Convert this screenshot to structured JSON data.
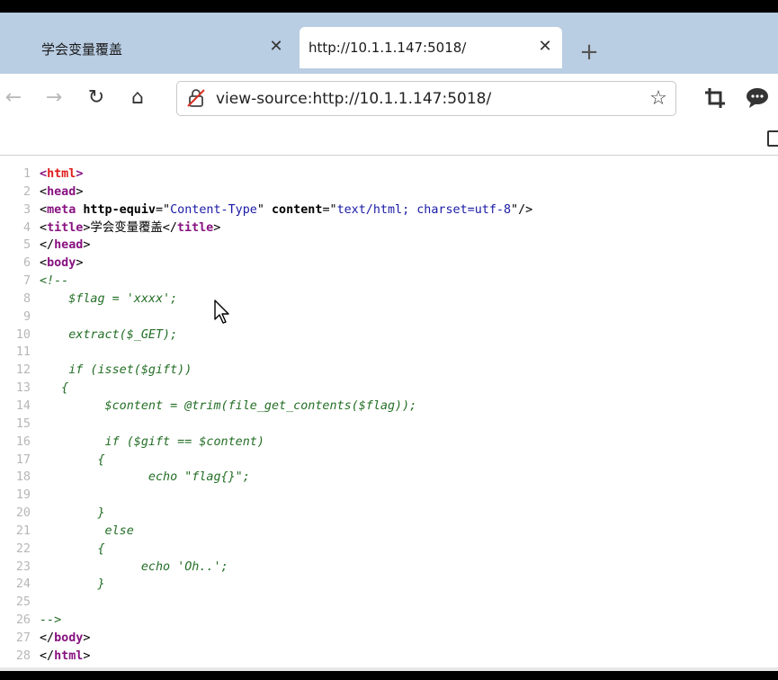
{
  "tabs": [
    {
      "title": "学会变量覆盖",
      "close": "✕"
    },
    {
      "title": "http://10.1.1.147:5018/",
      "close": "✕"
    }
  ],
  "new_tab": "+",
  "nav": {
    "back": "←",
    "forward": "→",
    "reload": "↻",
    "home": "⌂",
    "bookmark": "☆"
  },
  "address": {
    "url": "view-source:http://10.1.1.147:5018/"
  },
  "source_lines": [
    {
      "n": "1",
      "tokens": [
        {
          "c": "t-tag",
          "t": "<"
        },
        {
          "c": "t-root",
          "t": "html"
        },
        {
          "c": "t-tag",
          "t": ">"
        }
      ]
    },
    {
      "n": "2",
      "tokens": [
        {
          "c": "t-txt",
          "t": "<"
        },
        {
          "c": "t-tag",
          "t": "head"
        },
        {
          "c": "t-txt",
          "t": ">"
        }
      ]
    },
    {
      "n": "3",
      "tokens": [
        {
          "c": "t-txt",
          "t": "<"
        },
        {
          "c": "t-tag",
          "t": "meta"
        },
        {
          "c": "t-txt",
          "t": " "
        },
        {
          "c": "t-attr",
          "t": "http-equiv"
        },
        {
          "c": "t-txt",
          "t": "=\""
        },
        {
          "c": "t-val",
          "t": "Content-Type"
        },
        {
          "c": "t-txt",
          "t": "\" "
        },
        {
          "c": "t-attr",
          "t": "content"
        },
        {
          "c": "t-txt",
          "t": "=\""
        },
        {
          "c": "t-val",
          "t": "text/html; charset=utf-8"
        },
        {
          "c": "t-txt",
          "t": "\"/>"
        }
      ]
    },
    {
      "n": "4",
      "tokens": [
        {
          "c": "t-txt",
          "t": "<"
        },
        {
          "c": "t-tag",
          "t": "title"
        },
        {
          "c": "t-txt",
          "t": ">学会变量覆盖</"
        },
        {
          "c": "t-tag",
          "t": "title"
        },
        {
          "c": "t-txt",
          "t": ">"
        }
      ]
    },
    {
      "n": "5",
      "tokens": [
        {
          "c": "t-txt",
          "t": "</"
        },
        {
          "c": "t-tag",
          "t": "head"
        },
        {
          "c": "t-txt",
          "t": ">"
        }
      ]
    },
    {
      "n": "6",
      "tokens": [
        {
          "c": "t-txt",
          "t": "<"
        },
        {
          "c": "t-tag",
          "t": "body"
        },
        {
          "c": "t-txt",
          "t": ">"
        }
      ]
    },
    {
      "n": "7",
      "tokens": [
        {
          "c": "t-cmt",
          "t": "<!--"
        }
      ]
    },
    {
      "n": "8",
      "tokens": [
        {
          "c": "t-cmt",
          "t": "    $flag = 'xxxx';"
        }
      ]
    },
    {
      "n": "9",
      "tokens": []
    },
    {
      "n": "10",
      "tokens": [
        {
          "c": "t-cmt",
          "t": "    extract($_GET);"
        }
      ]
    },
    {
      "n": "11",
      "tokens": []
    },
    {
      "n": "12",
      "tokens": [
        {
          "c": "t-cmt",
          "t": "    if (isset($gift))"
        }
      ]
    },
    {
      "n": "13",
      "tokens": [
        {
          "c": "t-cmt",
          "t": "   {"
        }
      ]
    },
    {
      "n": "14",
      "tokens": [
        {
          "c": "t-cmt",
          "t": "         $content = @trim(file_get_contents($flag));"
        }
      ]
    },
    {
      "n": "15",
      "tokens": []
    },
    {
      "n": "16",
      "tokens": [
        {
          "c": "t-cmt",
          "t": "         if ($gift == $content)"
        }
      ]
    },
    {
      "n": "17",
      "tokens": [
        {
          "c": "t-cmt",
          "t": "        {"
        }
      ]
    },
    {
      "n": "18",
      "tokens": [
        {
          "c": "t-cmt",
          "t": "               echo \"flag{}\";"
        }
      ]
    },
    {
      "n": "19",
      "tokens": []
    },
    {
      "n": "20",
      "tokens": [
        {
          "c": "t-cmt",
          "t": "        }"
        }
      ]
    },
    {
      "n": "21",
      "tokens": [
        {
          "c": "t-cmt",
          "t": "         else"
        }
      ]
    },
    {
      "n": "22",
      "tokens": [
        {
          "c": "t-cmt",
          "t": "        {"
        }
      ]
    },
    {
      "n": "23",
      "tokens": [
        {
          "c": "t-cmt",
          "t": "              echo 'Oh..';"
        }
      ]
    },
    {
      "n": "24",
      "tokens": [
        {
          "c": "t-cmt",
          "t": "        }"
        }
      ]
    },
    {
      "n": "25",
      "tokens": []
    },
    {
      "n": "26",
      "tokens": [
        {
          "c": "t-cmt",
          "t": "-->"
        }
      ]
    },
    {
      "n": "27",
      "tokens": [
        {
          "c": "t-txt",
          "t": "</"
        },
        {
          "c": "t-tag",
          "t": "body"
        },
        {
          "c": "t-txt",
          "t": ">"
        }
      ]
    },
    {
      "n": "28",
      "tokens": [
        {
          "c": "t-txt",
          "t": "</"
        },
        {
          "c": "t-tag",
          "t": "html"
        },
        {
          "c": "t-txt",
          "t": ">"
        }
      ]
    }
  ],
  "icons": {
    "lock": "not-secure-lock-icon",
    "star": "star-icon",
    "crop": "crop-icon",
    "chat": "chat-icon",
    "sidebar": "sidebar-icon",
    "cursor": "mouse-pointer-icon"
  }
}
